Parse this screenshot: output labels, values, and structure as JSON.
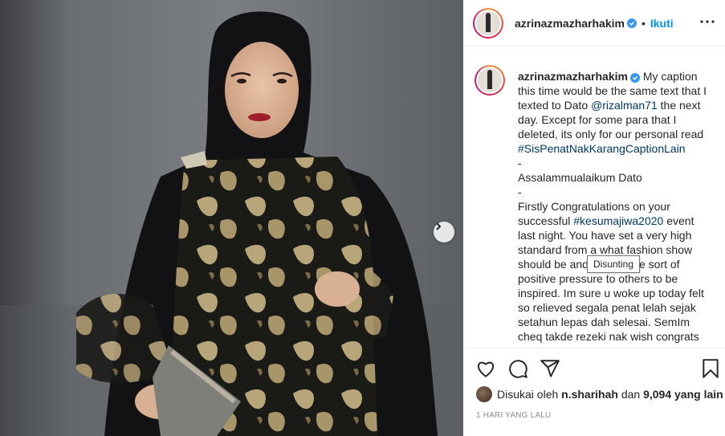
{
  "post": {
    "username": "azrinazmazharhakim",
    "follow_label": "Ikuti",
    "dot": "•",
    "caption_lines": [
      "My caption this time would be the same text that I texted to Dato ",
      "@rizalman71",
      " the next day. Except for some para that I deleted, its only for our personal read ",
      "#SisPenatNakKarangCaptionLain",
      "-",
      "Assalammualaikum Dato",
      "-",
      "Firstly Congratulations on your successful ",
      "#kesumajiwa2020",
      " event last night. You have set a very high standard from a what fashion show should be and it gives the sort of positive pressure to others to be inspired. Im sure u woke up today felt so relieved segala penat lelah sejak setahun lepas dah selesai. SemIm cheq takde rezeki nak wish congrats"
    ],
    "likes_prefix": "Disukai oleh",
    "likes_user": "n.sharihah",
    "likes_and": "dan",
    "likes_count": "9,094 yang lain",
    "timestamp": "1 HARI YANG LALU",
    "tooltip": "Disunting"
  },
  "colors": {
    "link": "#00376b",
    "follow": "#0095f6",
    "verified": "#3897f0",
    "muted": "#8e8e8e"
  },
  "icons": [
    "heart-icon",
    "comment-icon",
    "share-icon",
    "bookmark-icon",
    "more-icon",
    "verified-icon",
    "chevron-right-icon"
  ]
}
